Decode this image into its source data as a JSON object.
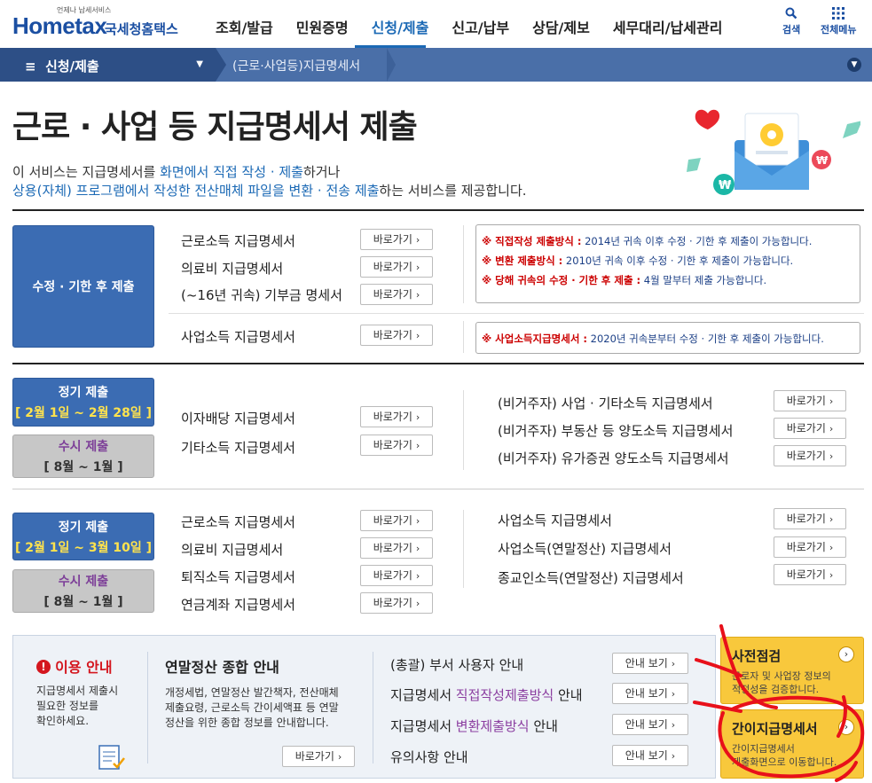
{
  "header": {
    "logo_brand": "Hometax",
    "logo_tagline": "언제나 납세서비스",
    "logo_kor": "국세청홈택스",
    "nav": [
      "조회/발급",
      "민원증명",
      "신청/제출",
      "신고/납부",
      "상담/제보",
      "세무대리/납세관리"
    ],
    "search_label": "검색",
    "allmenu_label": "전체메뉴"
  },
  "subbar": {
    "menu_label": "신청/제출",
    "breadcrumb": "(근로·사업등)지급명세서"
  },
  "page": {
    "title": "근로 · 사업 등 지급명세서 제출",
    "desc1_a": "이 서비스는 지급명세서를 ",
    "desc1_hl": "화면에서 직접 작성 · 제출",
    "desc1_b": "하거나",
    "desc2_hl": "상용(자체) 프로그램에서 작성한 전산매체 파일을 변환 · 전송 제출",
    "desc2_b": "하는 서비스를 제공합니다."
  },
  "go_label": "바로가기",
  "view_label": "안내 보기",
  "section1": {
    "block": "수정 · 기한 후 제출",
    "items": [
      "근로소득 지급명세서",
      "의료비 지급명세서",
      "(~16년 귀속) 기부금 명세서"
    ],
    "item2": "사업소득 지급명세서",
    "notes": [
      {
        "label": "※ 직접작성 제출방식 :",
        "text": " 2014년 귀속 이후 수정 · 기한 후 제출이 가능합니다."
      },
      {
        "label": "※ 변환 제출방식 :",
        "text": " 2010년 귀속 이후 수정 · 기한 후 제출이 가능합니다."
      },
      {
        "label": "※ 당해 귀속의 수정 · 기한 후 제출 :",
        "text": " 4월 말부터 제출 가능합니다."
      }
    ],
    "note2": {
      "label": "※ 사업소득지급명세서 :",
      "text": " 2020년 귀속분부터 수정 · 기한 후 제출이 가능합니다."
    }
  },
  "section2": {
    "regular_label": "정기 제출",
    "regular_period": "[ 2월 1일 ~ 2월 28일 ]",
    "adhoc_label": "수시 제출",
    "adhoc_period": "[ 8월 ~ 1월 ]",
    "left_items": [
      "이자배당 지급명세서",
      "기타소득 지급명세서"
    ],
    "right_items": [
      "(비거주자) 사업 · 기타소득 지급명세서",
      "(비거주자) 부동산 등 양도소득 지급명세서",
      "(비거주자) 유가증권 양도소득 지급명세서"
    ]
  },
  "section3": {
    "regular_label": "정기 제출",
    "regular_period": "[ 2월 1일 ~ 3월 10일 ]",
    "adhoc_label": "수시 제출",
    "adhoc_period": "[ 8월 ~ 1월 ]",
    "left_items": [
      "근로소득 지급명세서",
      "의료비 지급명세서",
      "퇴직소득 지급명세서",
      "연금계좌 지급명세서"
    ],
    "right_items": [
      "사업소득 지급명세서",
      "사업소득(연말정산) 지급명세서",
      "종교인소득(연말정산) 지급명세서"
    ]
  },
  "usage": {
    "title": "이용 안내",
    "text": [
      "지급명세서 제출시",
      "필요한 정보를",
      "확인하세요."
    ],
    "yearend_title": "연말정산 종합 안내",
    "yearend_text": [
      "개정세법, 연말정산 발간책자, 전산매체",
      "제출요령, 근로소득 간이세액표 등 연말",
      "정산을 위한 종합 정보를 안내합니다."
    ],
    "guides": [
      {
        "a": "(총괄) 부서 사용자 안내",
        "hl": "",
        "b": ""
      },
      {
        "a": "지급명세서 ",
        "hl": "직접작성제출방식",
        "b": " 안내"
      },
      {
        "a": "지급명세서 ",
        "hl": "변환제출방식",
        "b": " 안내"
      },
      {
        "a": "유의사항 안내",
        "hl": "",
        "b": ""
      }
    ]
  },
  "side": {
    "precheck_title": "사전점검",
    "precheck_text": [
      "근로자 및 사업장 정보의",
      "적정성을 검증합니다."
    ],
    "simple_title": "간이지급명세서",
    "simple_text": [
      "간이지급명세서",
      "제출화면으로 이동합니다."
    ]
  },
  "colors": {
    "brand": "#1b4fa2",
    "subbar": "#4a6fa8",
    "block_blue": "#3b6cb3",
    "period_yellow": "#ffe34d",
    "note_red": "#cc0000",
    "side_yellow": "#f8c83c",
    "annotation_red": "#e8101a"
  },
  "icons": [
    "search-icon",
    "grid-menu-icon",
    "hamburger-icon",
    "chevron-right-icon",
    "chevron-down-icon",
    "alert-icon",
    "document-check-icon",
    "envelope-illustration"
  ]
}
